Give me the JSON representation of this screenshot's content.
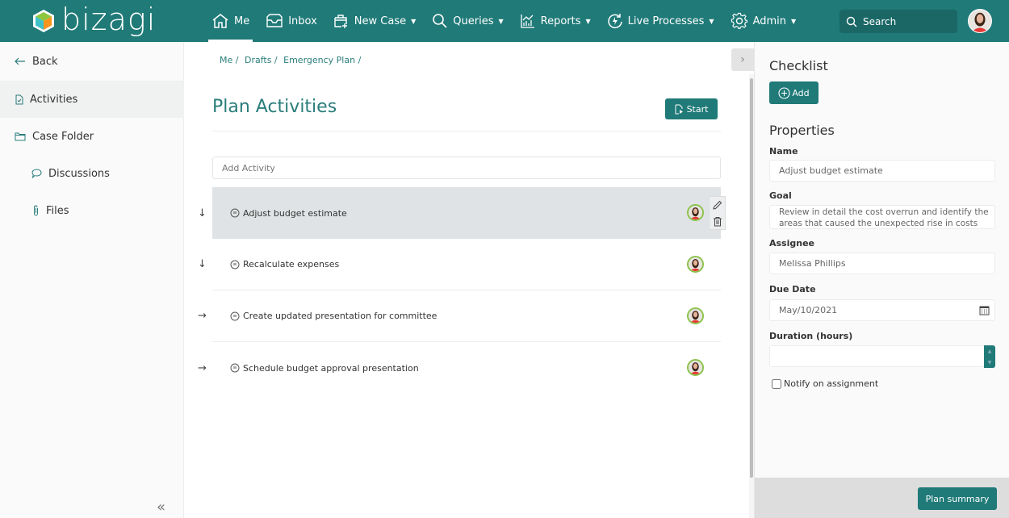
{
  "app": {
    "name": "bizagi"
  },
  "nav": {
    "items": [
      {
        "label": "Me",
        "icon": "home-icon",
        "active": true,
        "dropdown": false
      },
      {
        "label": "Inbox",
        "icon": "inbox-icon",
        "active": false,
        "dropdown": false
      },
      {
        "label": "New Case",
        "icon": "new-case-icon",
        "active": false,
        "dropdown": true
      },
      {
        "label": "Queries",
        "icon": "search-icon",
        "active": false,
        "dropdown": true
      },
      {
        "label": "Reports",
        "icon": "reports-icon",
        "active": false,
        "dropdown": true
      },
      {
        "label": "Live Processes",
        "icon": "live-processes-icon",
        "active": false,
        "dropdown": true
      },
      {
        "label": "Admin",
        "icon": "gear-icon",
        "active": false,
        "dropdown": true
      }
    ],
    "search_placeholder": "Search"
  },
  "sidebar": {
    "items": [
      {
        "label": "Back",
        "icon": "arrow-left-icon"
      },
      {
        "label": "Activities",
        "icon": "document-check-icon",
        "active": true
      },
      {
        "label": "Case Folder",
        "icon": "folder-icon"
      },
      {
        "label": "Discussions",
        "icon": "chat-bubble-icon"
      },
      {
        "label": "Files",
        "icon": "paperclip-icon"
      }
    ]
  },
  "main": {
    "breadcrumb": [
      "Me /",
      "Drafts /",
      "Emergency Plan /"
    ],
    "title": "Plan Activities",
    "start_label": "Start",
    "add_activity_placeholder": "Add Activity",
    "activities": [
      {
        "name": "Adjust budget estimate",
        "arrow": "↓",
        "selected": true
      },
      {
        "name": "Recalculate expenses",
        "arrow": "↓",
        "selected": false
      },
      {
        "name": "Create updated presentation for committee",
        "arrow": "→",
        "selected": false
      },
      {
        "name": "Schedule budget approval presentation",
        "arrow": "→",
        "selected": false
      }
    ]
  },
  "panel": {
    "checklist_title": "Checklist",
    "add_label": "Add",
    "properties_title": "Properties",
    "name_label": "Name",
    "name_value": "Adjust budget estimate",
    "goal_label": "Goal",
    "goal_value": "Review in detail the cost overrun and identify the areas that caused the unexpected rise in costs",
    "assignee_label": "Assignee",
    "assignee_value": "Melissa Phillips",
    "due_date_label": "Due Date",
    "due_date_value": "May/10/2021",
    "duration_label": "Duration (hours)",
    "duration_value": "",
    "notify_label": "Notify on assignment",
    "notify_checked": false,
    "summary_label": "Plan summary"
  },
  "colors": {
    "brand": "#1f7a78",
    "selected_row": "#e0e3e5"
  }
}
